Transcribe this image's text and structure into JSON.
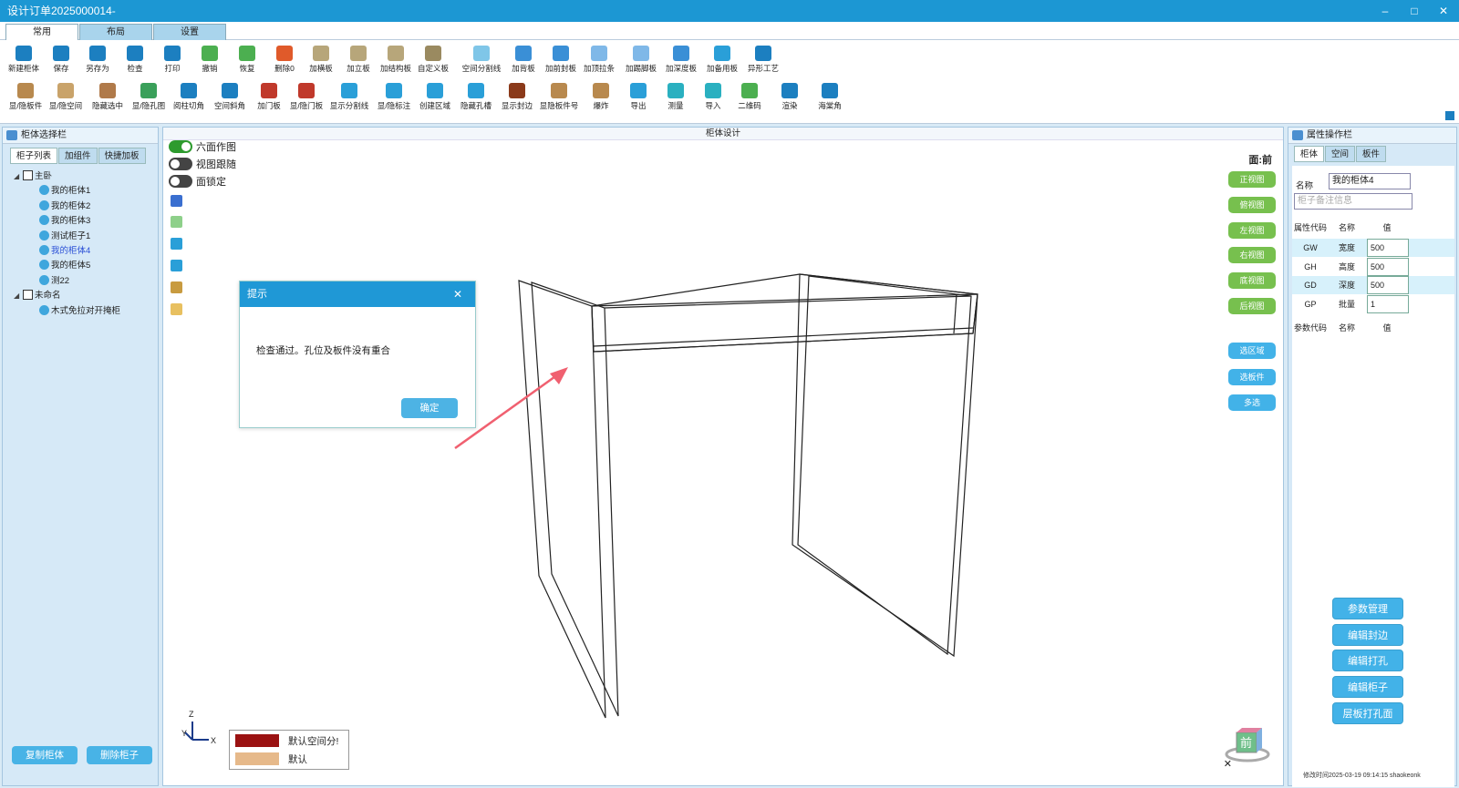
{
  "window": {
    "title": "设计订单2025000014-",
    "controls": [
      "–",
      "□",
      "✕"
    ]
  },
  "main_tabs": [
    {
      "label": "常用",
      "active": true
    },
    {
      "label": "布局",
      "active": false
    },
    {
      "label": "设置",
      "active": false
    }
  ],
  "ribbon": {
    "row1": [
      {
        "label": "新建柜体",
        "icon": "new-cabinet-icon",
        "color": "#1c7fc0"
      },
      {
        "label": "保存",
        "icon": "save-icon",
        "color": "#1c7fc0"
      },
      {
        "label": "另存为",
        "icon": "save-as-icon",
        "color": "#1c7fc0"
      },
      {
        "label": "检查",
        "icon": "check-icon",
        "color": "#1c7fc0"
      },
      {
        "label": "打印",
        "icon": "print-icon",
        "color": "#1c7fc0"
      },
      {
        "label": "撤销",
        "icon": "undo-icon",
        "color": "#4caf50"
      },
      {
        "label": "恢复",
        "icon": "redo-icon",
        "color": "#4caf50"
      },
      {
        "label": "删除0",
        "icon": "delete-icon",
        "color": "#e05a2a"
      },
      {
        "label": "加横板",
        "icon": "horizontal-board-icon",
        "color": "#b7a67a"
      },
      {
        "label": "加立板",
        "icon": "vertical-board-icon",
        "color": "#b7a67a"
      },
      {
        "label": "加结构板",
        "icon": "structure-board-icon",
        "color": "#b7a67a"
      },
      {
        "label": "自定义板",
        "icon": "custom-board-icon",
        "color": "#9a8a60"
      },
      {
        "label": "空间分割线",
        "icon": "split-line-icon",
        "color": "#7fc6e8"
      },
      {
        "label": "加背板",
        "icon": "back-board-icon",
        "color": "#3a8fd6"
      },
      {
        "label": "加前封板",
        "icon": "front-board-icon",
        "color": "#3a8fd6"
      },
      {
        "label": "加顶拉条",
        "icon": "top-strip-icon",
        "color": "#7fb8e8"
      },
      {
        "label": "加踢脚板",
        "icon": "kick-board-icon",
        "color": "#7fb8e8"
      },
      {
        "label": "加深度板",
        "icon": "depth-board-icon",
        "color": "#3a8fd6"
      },
      {
        "label": "加备用板",
        "icon": "spare-board-icon",
        "color": "#2a9fd8"
      },
      {
        "label": "异形工艺",
        "icon": "special-process-icon",
        "color": "#1c7fc0"
      }
    ],
    "row2": [
      {
        "label": "显/隐板件",
        "icon": "toggle-board-icon",
        "color": "#b8894e"
      },
      {
        "label": "显/隐空间",
        "icon": "toggle-space-icon",
        "color": "#c9a36a"
      },
      {
        "label": "隐藏选中",
        "icon": "hide-selected-icon",
        "color": "#b07a4a"
      },
      {
        "label": "显/隐孔图",
        "icon": "toggle-hole-icon",
        "color": "#3aa05a"
      },
      {
        "label": "阅柱切角",
        "icon": "column-cut-icon",
        "color": "#1c7fc0"
      },
      {
        "label": "空间斜角",
        "icon": "space-bevel-icon",
        "color": "#1c7fc0"
      },
      {
        "label": "加门板",
        "icon": "door-board-icon",
        "color": "#c0392b"
      },
      {
        "label": "显/隐门板",
        "icon": "toggle-door-icon",
        "color": "#c0392b"
      },
      {
        "label": "显示分割线",
        "icon": "show-split-icon",
        "color": "#2a9fd8"
      },
      {
        "label": "显/隐标注",
        "icon": "toggle-dimension-icon",
        "color": "#2a9fd8"
      },
      {
        "label": "创建区域",
        "icon": "create-area-icon",
        "color": "#2a9fd8"
      },
      {
        "label": "隐藏孔槽",
        "icon": "hide-slot-icon",
        "color": "#2a9fd8"
      },
      {
        "label": "显示封边",
        "icon": "show-edge-icon",
        "color": "#8b3a1a"
      },
      {
        "label": "显隐板件号",
        "icon": "board-number-icon",
        "color": "#b8894e"
      },
      {
        "label": "爆炸",
        "icon": "explode-icon",
        "color": "#b8894e"
      },
      {
        "label": "导出",
        "icon": "export-icon",
        "color": "#2a9fd8"
      },
      {
        "label": "测量",
        "icon": "measure-icon",
        "color": "#2ab0c0"
      },
      {
        "label": "导入",
        "icon": "import-icon",
        "color": "#2ab0c0"
      },
      {
        "label": "二维码",
        "icon": "qrcode-icon",
        "color": "#4caf50"
      },
      {
        "label": "渲染",
        "icon": "render-icon",
        "color": "#1c7fc0"
      },
      {
        "label": "海棠角",
        "icon": "crabapple-corner-icon",
        "color": "#1c7fc0"
      }
    ]
  },
  "left_panel": {
    "title": "柜体选择栏",
    "tabs": [
      {
        "label": "柜子列表",
        "active": true
      },
      {
        "label": "加组件",
        "active": false
      },
      {
        "label": "快捷加板",
        "active": false
      }
    ],
    "tree": [
      {
        "label": "主卧",
        "level": 0,
        "type": "folder",
        "expanded": true
      },
      {
        "label": "我的柜体1",
        "level": 1,
        "type": "leaf"
      },
      {
        "label": "我的柜体2",
        "level": 1,
        "type": "leaf"
      },
      {
        "label": "我的柜体3",
        "level": 1,
        "type": "leaf"
      },
      {
        "label": "测试柜子1",
        "level": 1,
        "type": "leaf"
      },
      {
        "label": "我的柜体4",
        "level": 1,
        "type": "leaf",
        "selected": true
      },
      {
        "label": "我的柜体5",
        "level": 1,
        "type": "leaf"
      },
      {
        "label": "测22",
        "level": 1,
        "type": "leaf"
      },
      {
        "label": "未命名",
        "level": 0,
        "type": "folder",
        "expanded": true
      },
      {
        "label": "木式免拉对开掩柜",
        "level": 1,
        "type": "leaf"
      }
    ],
    "copy_button": "复制柜体",
    "delete_button": "删除柜子"
  },
  "canvas": {
    "title": "柜体设计",
    "toggles": [
      {
        "label": "六面作图",
        "on": true
      },
      {
        "label": "视图跟随",
        "on": false
      },
      {
        "label": "面锁定",
        "on": false
      }
    ],
    "face_label": "面:前",
    "view_buttons": [
      "正视图",
      "俯视图",
      "左视图",
      "右视图",
      "底视图",
      "后视图"
    ],
    "select_buttons": [
      "选区域",
      "选板件",
      "多选"
    ],
    "legend": [
      {
        "label": "默认空间分!",
        "color": "#9b1212"
      },
      {
        "label": "默认",
        "color": "#e6b98a"
      }
    ],
    "axis_labels": {
      "z": "Z",
      "y": "Y",
      "x": "X"
    },
    "cube_label": "前",
    "close_mark": "✕"
  },
  "dialog": {
    "title": "提示",
    "close": "✕",
    "message": "检查通过。孔位及板件没有重合",
    "ok": "确定"
  },
  "right_panel": {
    "title": "属性操作栏",
    "tabs": [
      {
        "label": "柜体",
        "active": true
      },
      {
        "label": "空间",
        "active": false
      },
      {
        "label": "板件",
        "active": false
      }
    ],
    "name_label": "名称",
    "name_value": "我的柜体4",
    "remark_placeholder": "柜子备注信息",
    "attr_header": [
      "属性代码",
      "名称",
      "值"
    ],
    "attrs": [
      {
        "code": "GW",
        "name": "宽度",
        "value": "500"
      },
      {
        "code": "GH",
        "name": "高度",
        "value": "500"
      },
      {
        "code": "GD",
        "name": "深度",
        "value": "500"
      },
      {
        "code": "GP",
        "name": "批量",
        "value": "1"
      }
    ],
    "param_header": [
      "参数代码",
      "名称",
      "值"
    ],
    "buttons": [
      "参数管理",
      "编辑封边",
      "编辑打孔",
      "编辑柜子",
      "层板打孔面"
    ],
    "footer": "修改时间2025-03-19 09:14:15 shaokeonk"
  }
}
